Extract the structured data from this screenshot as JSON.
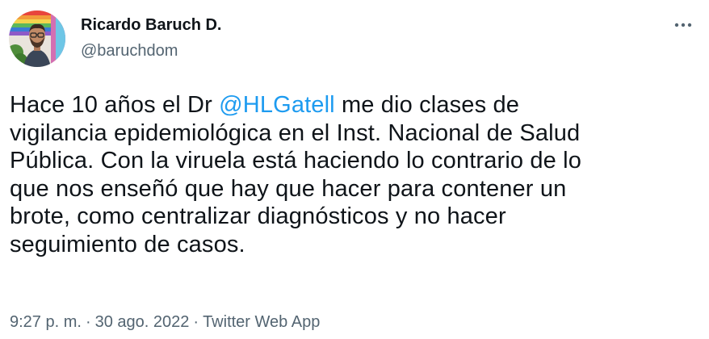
{
  "author": {
    "display_name": "Ricardo Baruch D.",
    "handle": "@baruchdom"
  },
  "menu": {
    "icon": "more-horizontal-icon"
  },
  "tweet": {
    "lines": [
      {
        "before": "Hace 10 años el Dr ",
        "mention": "@HLGatell",
        "after": " me dio clases de"
      },
      {
        "text": "vigilancia epidemiológica en el Inst. Nacional de Salud"
      },
      {
        "text": "Pública. Con la viruela está haciendo lo contrario de lo"
      },
      {
        "text": "que nos enseñó que hay que hacer para contener un"
      },
      {
        "text": "brote, como centralizar diagnósticos y no hacer"
      },
      {
        "text": "seguimiento de casos."
      }
    ]
  },
  "meta": {
    "time": "9:27 p. m.",
    "separator": "·",
    "date": "30 ago. 2022",
    "source": "Twitter Web App"
  },
  "colors": {
    "accent": "#1d9bf0",
    "text": "#0f1419",
    "secondary": "#536471"
  }
}
